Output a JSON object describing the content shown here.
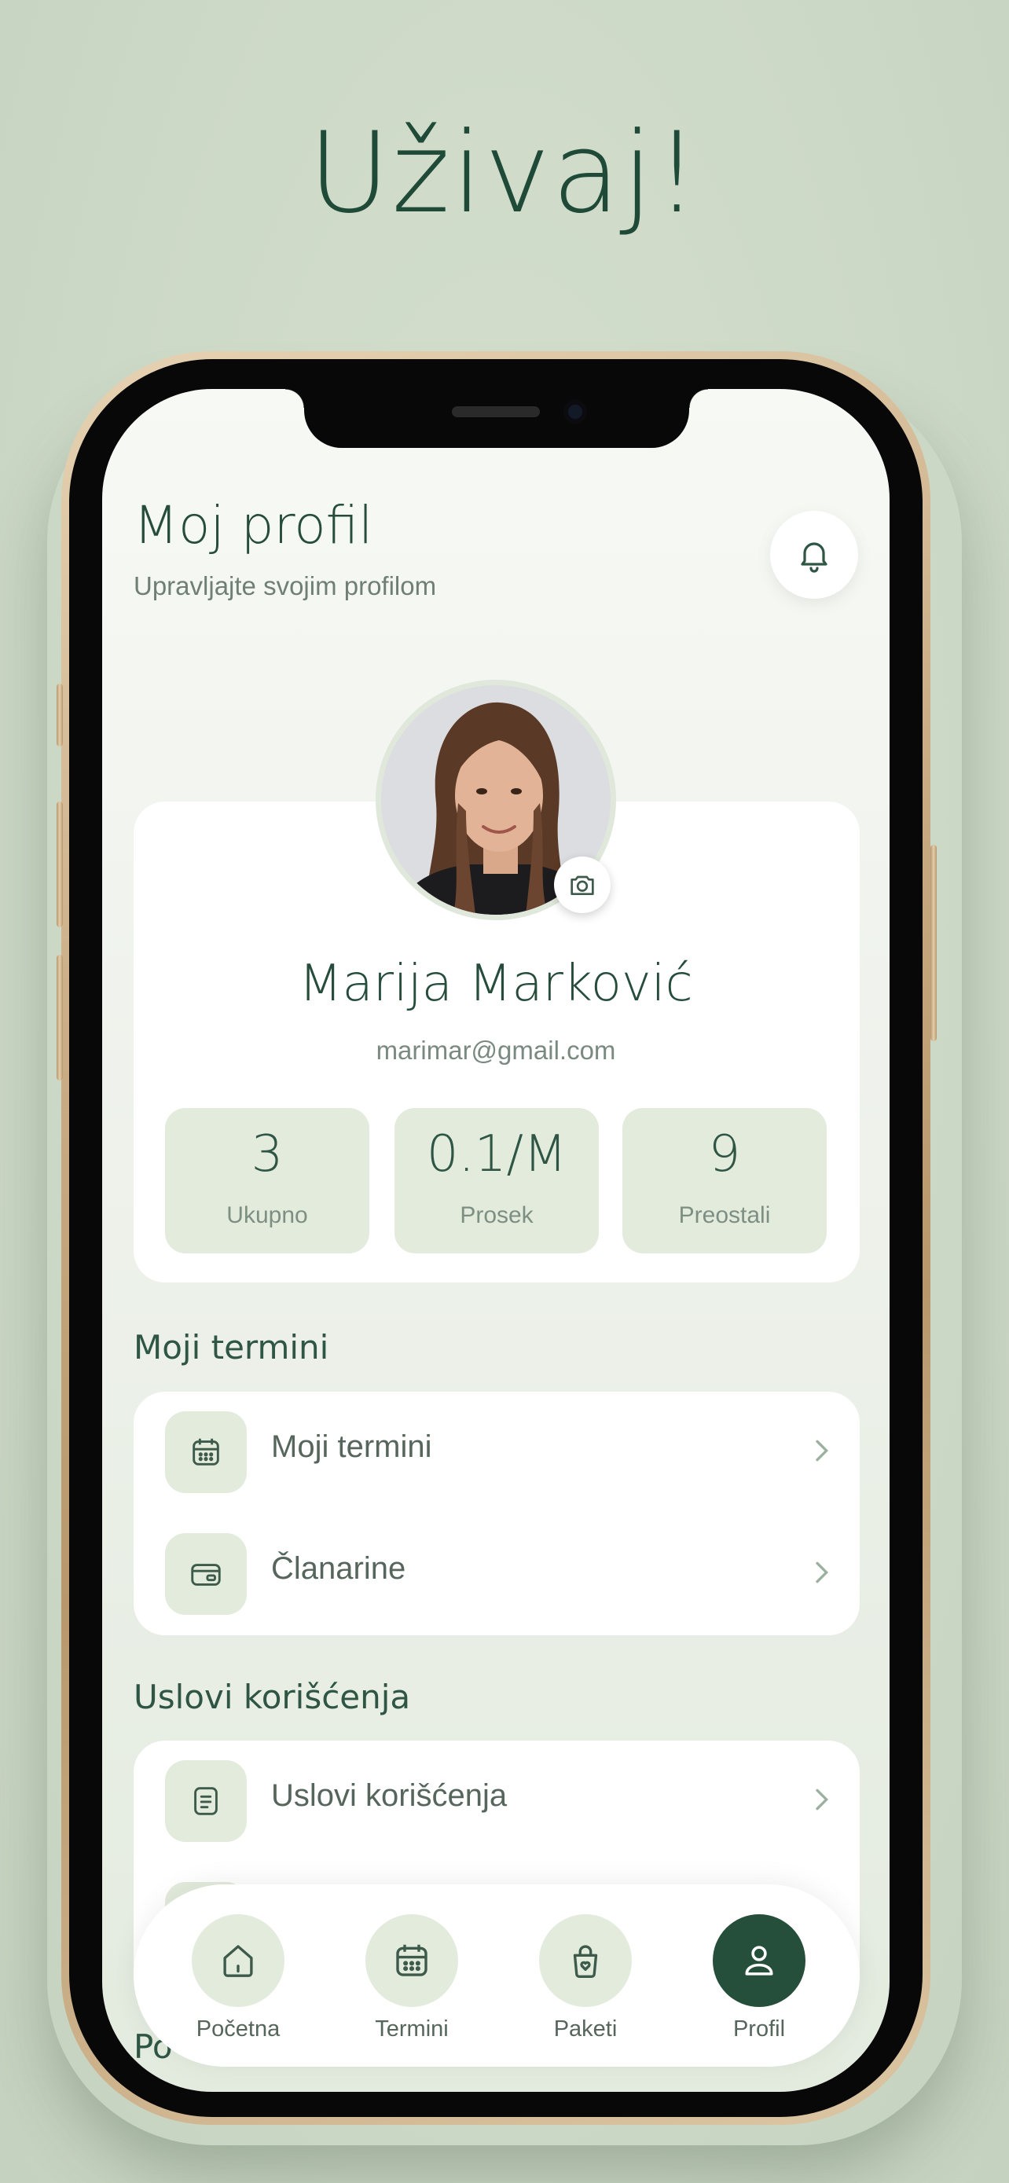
{
  "headline": "Uživaj!",
  "header": {
    "title": "Moj profil",
    "subtitle": "Upravljajte svojim profilom"
  },
  "profile": {
    "name": "Marija Marković",
    "email": "marimar@gmail.com"
  },
  "stats": [
    {
      "value": "3",
      "label": "Ukupno"
    },
    {
      "value": "0.1/M",
      "label": "Prosek"
    },
    {
      "value": "9",
      "label": "Preostali"
    }
  ],
  "sections": {
    "appointments": {
      "title": "Moji termini",
      "items": [
        {
          "label": "Moji termini",
          "icon": "calendar-icon"
        },
        {
          "label": "Članarine",
          "icon": "membership-card-icon"
        }
      ]
    },
    "terms": {
      "title": "Uslovi korišćenja",
      "items": [
        {
          "label": "Uslovi korišćenja",
          "icon": "document-icon"
        }
      ]
    },
    "peek_title": "Po"
  },
  "nav": {
    "items": [
      {
        "label": "Početna",
        "icon": "home-icon",
        "active": false
      },
      {
        "label": "Termini",
        "icon": "calendar-icon",
        "active": false
      },
      {
        "label": "Paketi",
        "icon": "bag-icon",
        "active": false
      },
      {
        "label": "Profil",
        "icon": "user-icon",
        "active": true
      }
    ]
  },
  "colors": {
    "accent": "#254e3b",
    "background": "#cfdbc9",
    "tile": "#e3ebdd"
  }
}
